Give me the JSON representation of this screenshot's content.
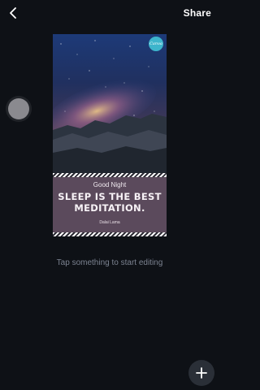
{
  "header": {
    "back_icon": "chevron-left-icon",
    "share_label": "Share"
  },
  "canvas": {
    "logo_text": "Canva",
    "greeting": "Good Night",
    "headline_line1": "SLEEP IS THE BEST",
    "headline_line2": "MEDITATION.",
    "author": "Dalai Lama",
    "colors": {
      "panel": "#5b4a5c",
      "stripe": "#ffffff"
    }
  },
  "hint": "Tap something to start editing",
  "fab": {
    "icon": "plus-icon"
  }
}
